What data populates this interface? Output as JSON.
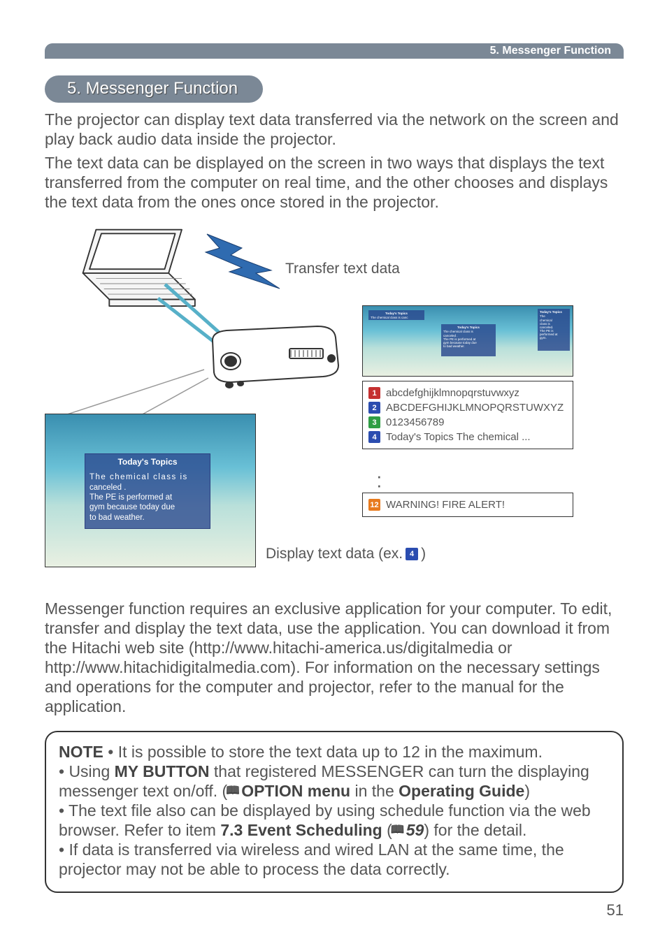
{
  "header": {
    "breadcrumb": "5. Messenger Function"
  },
  "heading": "5. Messenger Function",
  "para1": "The projector can display text data transferred via the network on the screen and play back audio data inside the projector.",
  "para2": "The text data can be displayed on the screen in two ways that displays the text transferred from the computer on real time, and the other chooses and displays the text data from the ones once stored in the projector.",
  "diagram": {
    "transfer_label": "Transfer text data",
    "overlay_title": "Today's Topics",
    "overlay_lines": {
      "l1a": "The chemical class is",
      "l1b": "canceled .",
      "l2a": "The PE is  performed at",
      "l2b": "gym because today due",
      "l2c": "to bad weather."
    },
    "thumb_small_title": "Today's Topics",
    "thumb_small_sub": "The chemical class is canc",
    "thumb_mid_title": "Today's Topics",
    "thumb_mid_l1": "The chemical class is",
    "thumb_mid_l2": "canceled .",
    "thumb_mid_l3": "The PE is  performed at",
    "thumb_mid_l4": "gym because today due",
    "thumb_mid_l5": "to bad weather.",
    "thumb_right_title": "Today's Topics",
    "thumb_right_l1": "The",
    "thumb_right_l2": "chemical",
    "thumb_right_l3": "class is",
    "thumb_right_l4": "canceled.",
    "thumb_right_l5": "The PE is",
    "thumb_right_l6": "performed at",
    "thumb_right_l7": "gym.",
    "list": [
      {
        "num": "1",
        "color": "red",
        "text": "abcdefghijklmnopqrstuvwxyz"
      },
      {
        "num": "2",
        "color": "blue",
        "text": "ABCDEFGHIJKLMNOPQRSTUWXYZ"
      },
      {
        "num": "3",
        "color": "green",
        "text": "0123456789"
      },
      {
        "num": "4",
        "color": "blue",
        "text": "Today's Topics The chemical ..."
      }
    ],
    "list2": {
      "num": "12",
      "color": "orange",
      "text": "WARNING! FIRE ALERT!"
    },
    "display_label_pre": "Display text data (ex. ",
    "display_badge": "4",
    "display_label_post": ")"
  },
  "para3": "Messenger function requires an exclusive application for your computer. To edit, transfer and display the text data, use the application. You can download it from the Hitachi web site (http://www.hitachi-america.us/digitalmedia or http://www.hitachidigitalmedia.com). For information on the necessary settings and operations for the computer and projector, refer to the manual for the application.",
  "note": {
    "label": "NOTE",
    "b1": " • It is possible to store the text data up to 12 in the maximum.",
    "b2a": "• Using ",
    "b2b": "MY BUTTON",
    "b2c": " that registered MESSENGER can turn the displaying messenger text on/off. (",
    "b2d": "OPTION menu",
    "b2e": " in the ",
    "b2f": "Operating Guide",
    "b2g": ")",
    "b3a": "• The text file also can be displayed by using schedule function via the web browser. Refer to item ",
    "b3b": "7.3 Event Scheduling",
    "b3c": " (",
    "b3d": "59",
    "b3e": ") for the detail.",
    "b4": "• If data is transferred via wireless and wired LAN at the same time, the projector may not be able to process the data correctly."
  },
  "page_number": "51"
}
